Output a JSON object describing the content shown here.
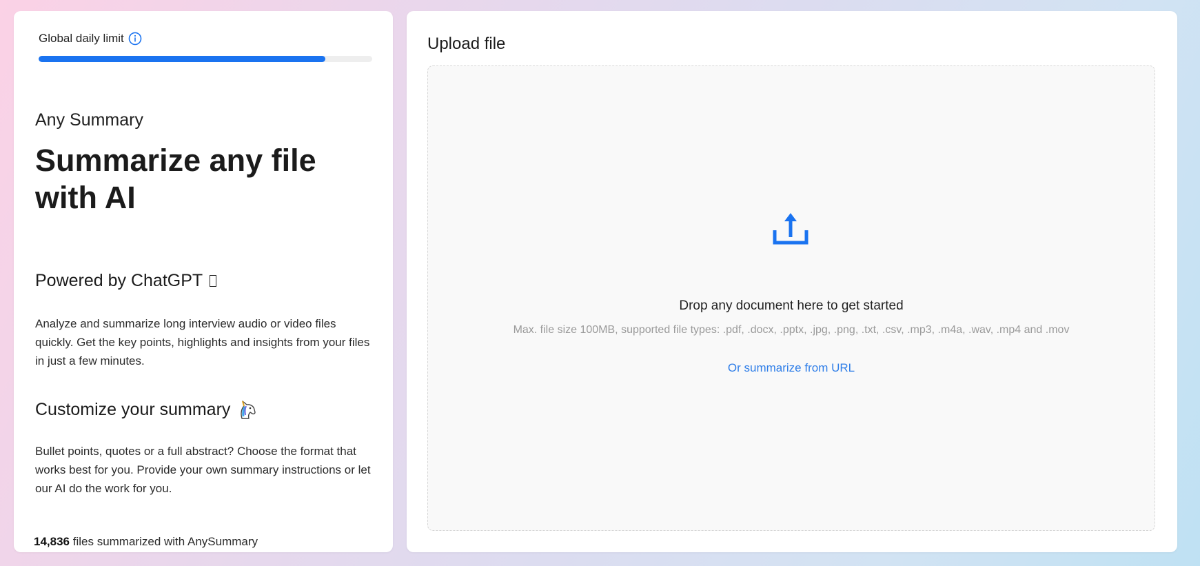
{
  "limit": {
    "label": "Global daily limit",
    "icon": "info-icon",
    "progress_fraction": 0.86,
    "accent_color": "#1a73f0"
  },
  "intro": {
    "app_name": "Any Summary",
    "headline": "Summarize any file with AI"
  },
  "sections": [
    {
      "title": "Powered by ChatGPT",
      "icon": "unsupported-glyph-box",
      "text": "Analyze and summarize long interview audio or video files quickly. Get the key points, highlights and insights from your files in just a few minutes."
    },
    {
      "title": "Customize your summary",
      "icon": "unicorn-icon",
      "text": "Bullet points, quotes or a full abstract? Choose the format that works best for you. Provide your own summary instructions or let our AI do the work for you."
    }
  ],
  "stats": {
    "count": "14,836",
    "suffix": "files summarized with AnySummary"
  },
  "upload": {
    "title": "Upload file",
    "icon": "upload-icon",
    "drop_text": "Drop any document here to get started",
    "drop_subtext": "Max. file size 100MB, supported file types: .pdf, .docx, .pptx, .jpg, .png, .txt, .csv, .mp3, .m4a, .wav, .mp4 and .mov",
    "url_link": "Or summarize from URL",
    "link_color": "#2f7ee8"
  }
}
